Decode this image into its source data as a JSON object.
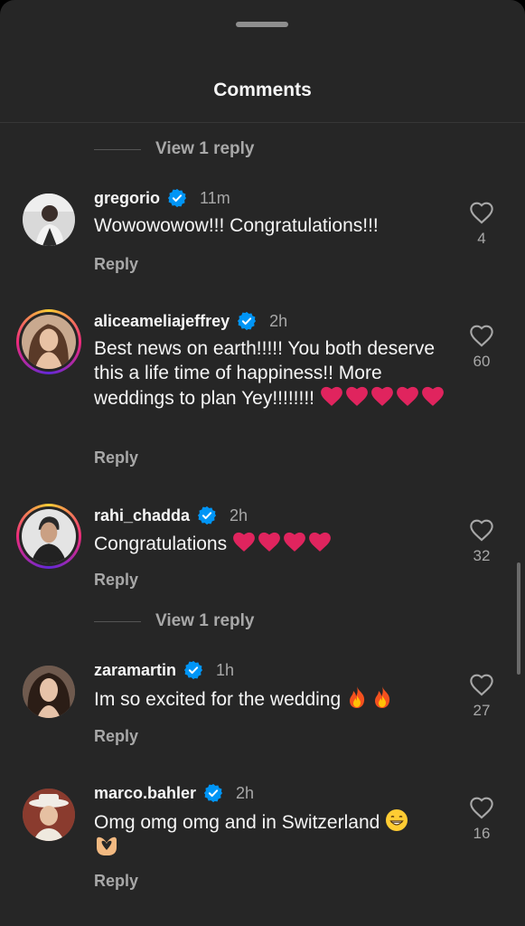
{
  "header": {
    "title": "Comments"
  },
  "view_replies": [
    {
      "label": "View 1 reply"
    },
    {
      "label": "View 1 reply"
    }
  ],
  "comments": [
    {
      "username": "gregorio",
      "time": "11m",
      "text": "Wowowowow!!! Congratulations!!!",
      "reply": "Reply",
      "likes": "4"
    },
    {
      "username": "aliceameliajeffrey",
      "time": "2h",
      "text": "Best news on earth!!!!! You both deserve this a life time of happiness!! More weddings to plan Yey!!!!!!!!",
      "reply": "Reply",
      "likes": "60"
    },
    {
      "username": "rahi_chadda",
      "time": "2h",
      "text": "Congratulations",
      "reply": "Reply",
      "likes": "32"
    },
    {
      "username": "zaramartin",
      "time": "1h",
      "text": "Im so excited for the wedding",
      "reply": "Reply",
      "likes": "27"
    },
    {
      "username": "marco.bahler",
      "time": "2h",
      "text": "Omg omg omg and in Switzerland",
      "reply": "Reply",
      "likes": "16"
    }
  ],
  "icons": {
    "verified": "verified-badge-icon",
    "like": "heart-outline-icon",
    "emoji_heart": "red-heart-emoji",
    "emoji_fire": "fire-emoji",
    "emoji_grin": "grinning-face-emoji",
    "emoji_hands": "heart-hands-emoji"
  },
  "colors": {
    "background": "#262626",
    "verified": "#0095f6",
    "secondary_text": "#a8a8a8",
    "heart_emoji": "#e0245e"
  }
}
